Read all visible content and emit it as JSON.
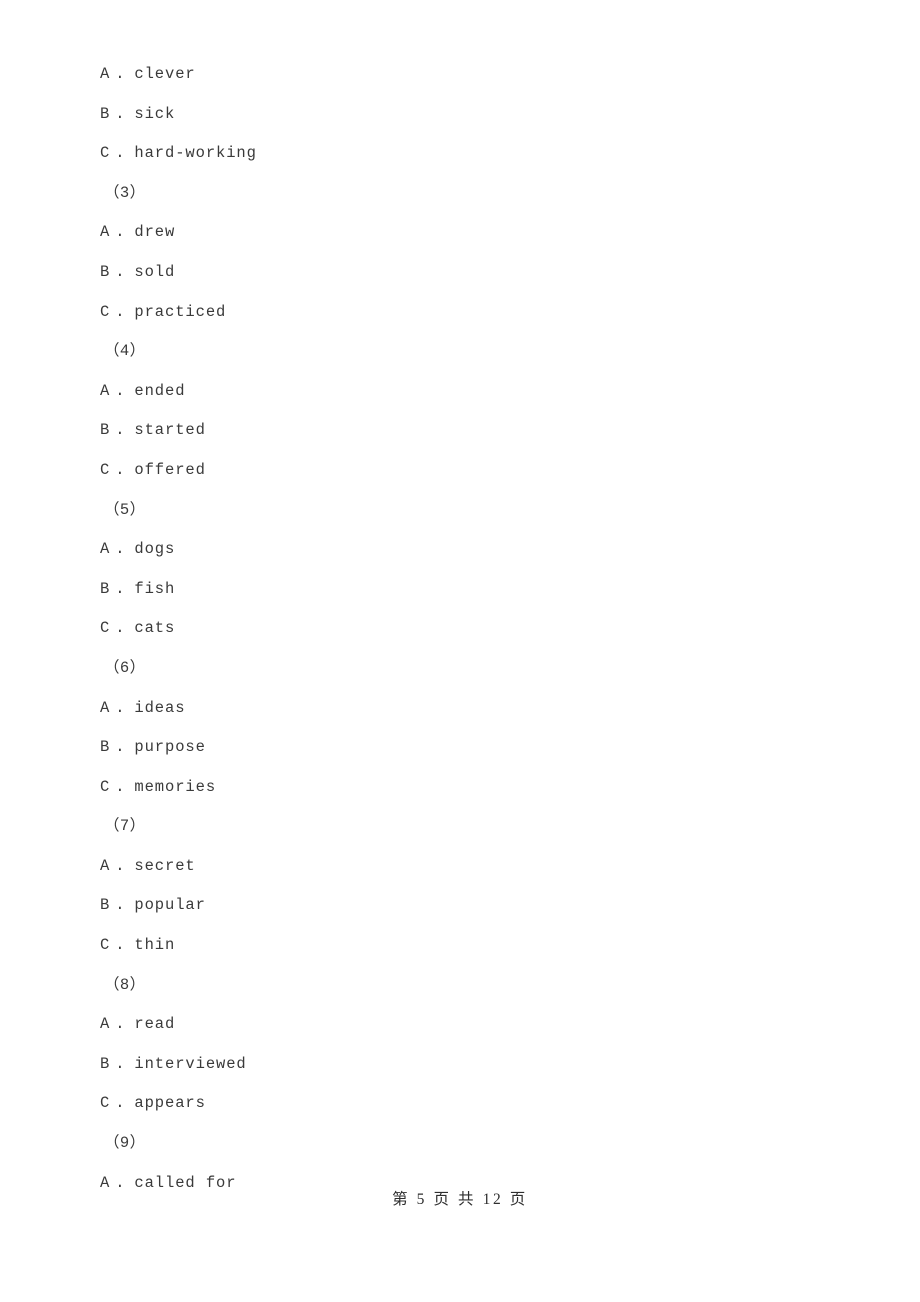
{
  "document": {
    "page_background": "#ffffff",
    "text_color": "#3a3a3a",
    "footer_color": "#2e2e2e"
  },
  "content": {
    "lines": [
      {
        "kind": "option",
        "letter": "A",
        "dot": ".",
        "text": "clever"
      },
      {
        "kind": "option",
        "letter": "B",
        "dot": ".",
        "text": "sick"
      },
      {
        "kind": "option",
        "letter": "C",
        "dot": ".",
        "text": "hard-working"
      },
      {
        "kind": "group",
        "label": "（3）"
      },
      {
        "kind": "option",
        "letter": "A",
        "dot": ".",
        "text": "drew"
      },
      {
        "kind": "option",
        "letter": "B",
        "dot": ".",
        "text": "sold"
      },
      {
        "kind": "option",
        "letter": "C",
        "dot": ".",
        "text": "practiced"
      },
      {
        "kind": "group",
        "label": "（4）"
      },
      {
        "kind": "option",
        "letter": "A",
        "dot": ".",
        "text": "ended"
      },
      {
        "kind": "option",
        "letter": "B",
        "dot": ".",
        "text": "started"
      },
      {
        "kind": "option",
        "letter": "C",
        "dot": ".",
        "text": "offered"
      },
      {
        "kind": "group",
        "label": "（5）"
      },
      {
        "kind": "option",
        "letter": "A",
        "dot": ".",
        "text": "dogs"
      },
      {
        "kind": "option",
        "letter": "B",
        "dot": ".",
        "text": "fish"
      },
      {
        "kind": "option",
        "letter": "C",
        "dot": ".",
        "text": "cats"
      },
      {
        "kind": "group",
        "label": "（6）"
      },
      {
        "kind": "option",
        "letter": "A",
        "dot": ".",
        "text": "ideas"
      },
      {
        "kind": "option",
        "letter": "B",
        "dot": ".",
        "text": "purpose"
      },
      {
        "kind": "option",
        "letter": "C",
        "dot": ".",
        "text": "memories"
      },
      {
        "kind": "group",
        "label": "（7）"
      },
      {
        "kind": "option",
        "letter": "A",
        "dot": ".",
        "text": "secret"
      },
      {
        "kind": "option",
        "letter": "B",
        "dot": ".",
        "text": "popular"
      },
      {
        "kind": "option",
        "letter": "C",
        "dot": ".",
        "text": "thin"
      },
      {
        "kind": "group",
        "label": "（8）"
      },
      {
        "kind": "option",
        "letter": "A",
        "dot": ".",
        "text": "read"
      },
      {
        "kind": "option",
        "letter": "B",
        "dot": ".",
        "text": "interviewed"
      },
      {
        "kind": "option",
        "letter": "C",
        "dot": ".",
        "text": "appears"
      },
      {
        "kind": "group",
        "label": "（9）"
      },
      {
        "kind": "option",
        "letter": "A",
        "dot": ".",
        "text": "called for"
      }
    ]
  },
  "footer": {
    "text": "第 5 页 共 12 页",
    "current_page": "5",
    "total_pages": "12"
  }
}
